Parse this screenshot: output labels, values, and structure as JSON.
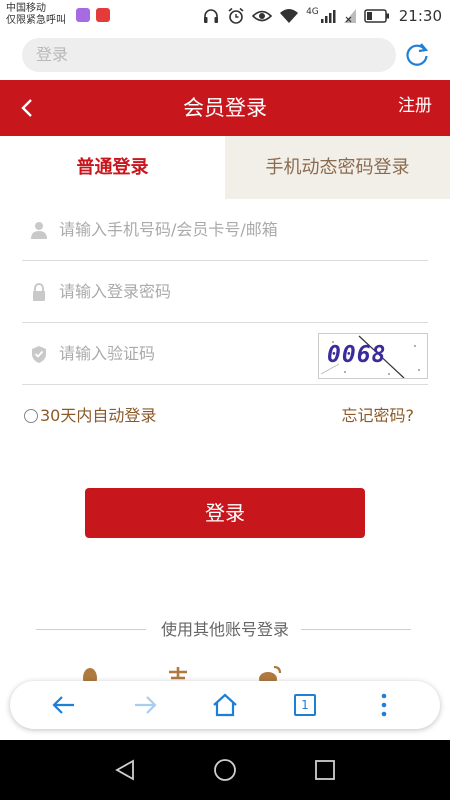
{
  "statusbar": {
    "carrier": "中国移动",
    "carrier_note": "仅限紧急呼叫",
    "network": "4G",
    "time": "21:30"
  },
  "browser": {
    "url_text": "登录"
  },
  "header": {
    "title": "会员登录",
    "register": "注册"
  },
  "tabs": [
    {
      "label": "普通登录",
      "active": true
    },
    {
      "label": "手机动态密码登录",
      "active": false
    }
  ],
  "form": {
    "account_placeholder": "请输入手机号码/会员卡号/邮箱",
    "password_placeholder": "请输入登录密码",
    "captcha_placeholder": "请输入验证码",
    "captcha_text": "0068",
    "auto_login": "30天内自动登录",
    "forgot": "忘记密码?",
    "login_button": "登录"
  },
  "other_login": {
    "label": "使用其他账号登录",
    "providers": [
      "qq-icon",
      "alipay-icon",
      "weibo-icon"
    ]
  },
  "colors": {
    "brand_red": "#c8161d",
    "tab_inactive_bg": "#f2efe9",
    "link_brown": "#8b5a2b",
    "browser_blue": "#1e7fd6"
  }
}
